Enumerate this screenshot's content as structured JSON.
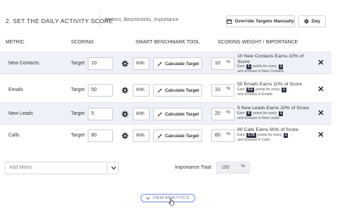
{
  "header": {
    "title": "2.  SET THE DAILY ACTIVITY SCORE",
    "subtitle": "Metrics, Benchmarks, Importance",
    "override_label": "Override Targets Manually",
    "period_label": "Day"
  },
  "columns": {
    "metric": "METRIC",
    "scoring": "SCORING",
    "benchmark": "SMART BENCHMARK TOOL",
    "weight": "SCORING WEIGHT / IMPORTANCE"
  },
  "rows": [
    {
      "name": "New Contacts",
      "target_label": "Target",
      "target": "10",
      "benchmark": "80th",
      "calc_label": "Calculate Target",
      "weight": "10",
      "pct": "%",
      "earn_title": "10 New Contacts Earns 10% of Score",
      "earn_prefix": "Earn",
      "points": "1",
      "points_mid": "points for every",
      "unit": "1",
      "unit_suffix": "unit increase in New Contacts"
    },
    {
      "name": "Emails",
      "target_label": "Target",
      "target": "50",
      "benchmark": "80th",
      "calc_label": "Calculate Target",
      "weight": "10",
      "pct": "%",
      "earn_title": "50 Emails Earns 10% of Score",
      "earn_prefix": "Earn",
      "points": "0.2",
      "points_mid": "points for every",
      "unit": "1",
      "unit_suffix": "unit increase in Emails"
    },
    {
      "name": "New Leads",
      "target_label": "Target",
      "target": "5",
      "benchmark": "80th",
      "calc_label": "Calculate Target",
      "weight": "20",
      "pct": "%",
      "earn_title": "5 New Leads Earns 20% of Score",
      "earn_prefix": "Earn",
      "points": "4",
      "points_mid": "points for every",
      "unit": "1",
      "unit_suffix": "unit increase in New Leads"
    },
    {
      "name": "Calls",
      "target_label": "Target",
      "target": "80",
      "benchmark": "80th",
      "calc_label": "Calculate Target",
      "weight": "60",
      "pct": "%",
      "earn_title": "80 Calls Earns 60% of Score",
      "earn_prefix": "Earn",
      "points": "0.75",
      "points_mid": "points for every",
      "unit": "1",
      "unit_suffix": "unit increase in Calls"
    }
  ],
  "footer": {
    "add_metric_placeholder": "Add Metric",
    "importance_label": "Importance Total",
    "importance_value": "100",
    "importance_pct": "%",
    "view_analytics": "VIEW ANALYTICS"
  }
}
